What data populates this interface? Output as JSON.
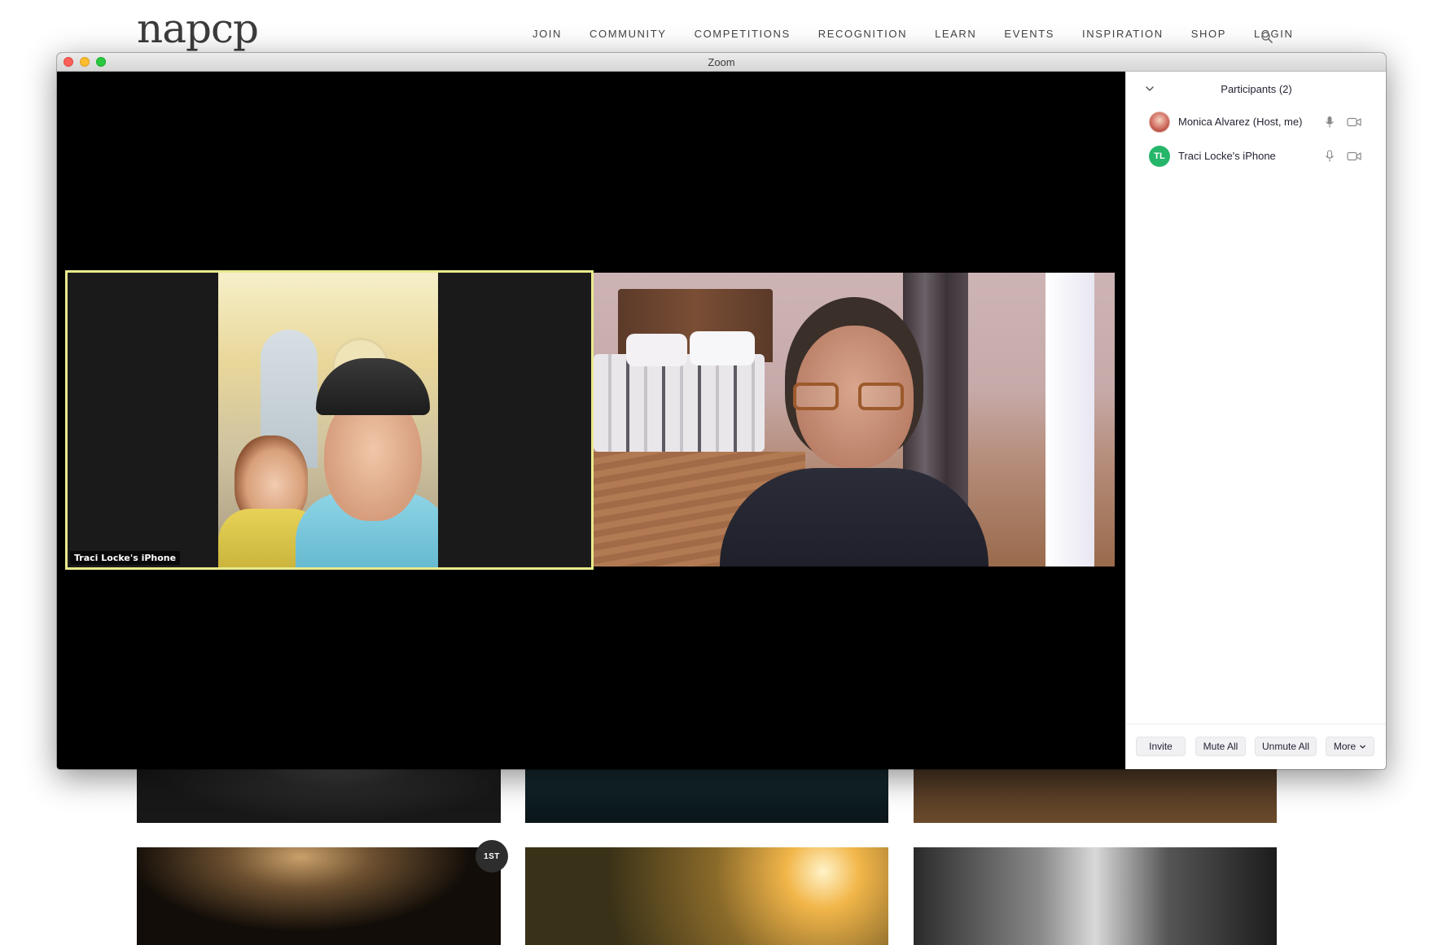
{
  "site": {
    "logo": "napcp",
    "nav": [
      "JOIN",
      "COMMUNITY",
      "COMPETITIONS",
      "RECOGNITION",
      "LEARN",
      "EVENTS",
      "INSPIRATION",
      "SHOP",
      "LOGIN"
    ],
    "search_icon": "search-icon",
    "award_badge": "1ST"
  },
  "zoom": {
    "window_title": "Zoom",
    "videos": [
      {
        "name_label": "Traci Locke's iPhone",
        "active_speaker": true
      },
      {
        "name_label": "",
        "active_speaker": false
      }
    ],
    "participants_panel": {
      "title": "Participants (2)",
      "participants": [
        {
          "name": "Monica Alvarez (Host, me)",
          "avatar": "photo",
          "initials": ""
        },
        {
          "name": "Traci Locke's iPhone",
          "avatar": "initials",
          "initials": "TL"
        }
      ],
      "buttons": {
        "invite": "Invite",
        "mute_all": "Mute All",
        "unmute_all": "Unmute All",
        "more": "More"
      }
    },
    "colors": {
      "active_border": "#e9ea8c",
      "initials_avatar": "#26b66a"
    }
  }
}
